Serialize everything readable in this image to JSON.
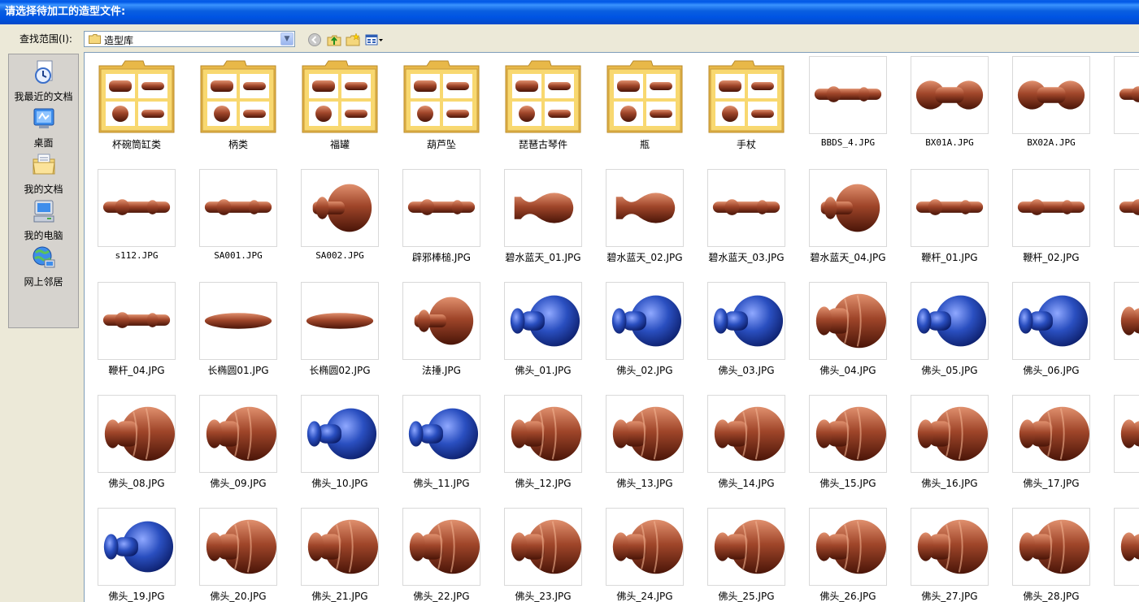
{
  "window": {
    "title": "请选择待加工的造型文件:"
  },
  "lookin": {
    "label": "查找范围(I):",
    "value": "造型库"
  },
  "places": [
    {
      "label": "我最近的文档",
      "icon": "recent-documents-icon"
    },
    {
      "label": "桌面",
      "icon": "desktop-icon"
    },
    {
      "label": "我的文档",
      "icon": "my-documents-icon"
    },
    {
      "label": "我的电脑",
      "icon": "my-computer-icon"
    },
    {
      "label": "网上邻居",
      "icon": "network-places-icon"
    }
  ],
  "files": [
    {
      "name": "杯碗筒缸类",
      "type": "folder"
    },
    {
      "name": "柄类",
      "type": "folder"
    },
    {
      "name": "福罐",
      "type": "folder"
    },
    {
      "name": "葫芦坠",
      "type": "folder"
    },
    {
      "name": "琵琶古琴件",
      "type": "folder"
    },
    {
      "name": "瓶",
      "type": "folder"
    },
    {
      "name": "手杖",
      "type": "folder"
    },
    {
      "name": "BBDS_4.JPG",
      "type": "rod"
    },
    {
      "name": "BX01A.JPG",
      "type": "bead"
    },
    {
      "name": "BX02A.JPG",
      "type": "bead"
    },
    {
      "name": "s",
      "type": "rod"
    },
    {
      "name": "s112.JPG",
      "type": "rod"
    },
    {
      "name": "SA001.JPG",
      "type": "rod"
    },
    {
      "name": "SA002.JPG",
      "type": "knob"
    },
    {
      "name": "辟邪棒槌.JPG",
      "type": "rod"
    },
    {
      "name": "碧水蓝天_01.JPG",
      "type": "vase"
    },
    {
      "name": "碧水蓝天_02.JPG",
      "type": "vase"
    },
    {
      "name": "碧水蓝天_03.JPG",
      "type": "rod"
    },
    {
      "name": "碧水蓝天_04.JPG",
      "type": "knob"
    },
    {
      "name": "鞭杆_01.JPG",
      "type": "rod"
    },
    {
      "name": "鞭杆_02.JPG",
      "type": "rod"
    },
    {
      "name": "鞭杆",
      "type": "rod"
    },
    {
      "name": "鞭杆_04.JPG",
      "type": "rod"
    },
    {
      "name": "长椭圆01.JPG",
      "type": "ellipse"
    },
    {
      "name": "长椭圆02.JPG",
      "type": "ellipse"
    },
    {
      "name": "法捶.JPG",
      "type": "knob"
    },
    {
      "name": "佛头_01.JPG",
      "type": "bluehead"
    },
    {
      "name": "佛头_02.JPG",
      "type": "bluehead"
    },
    {
      "name": "佛头_03.JPG",
      "type": "bluehead"
    },
    {
      "name": "佛头_04.JPG",
      "type": "head"
    },
    {
      "name": "佛头_05.JPG",
      "type": "bluehead"
    },
    {
      "name": "佛头_06.JPG",
      "type": "bluehead"
    },
    {
      "name": "佛头",
      "type": "head"
    },
    {
      "name": "佛头_08.JPG",
      "type": "head"
    },
    {
      "name": "佛头_09.JPG",
      "type": "head"
    },
    {
      "name": "佛头_10.JPG",
      "type": "bluehead"
    },
    {
      "name": "佛头_11.JPG",
      "type": "bluehead"
    },
    {
      "name": "佛头_12.JPG",
      "type": "head"
    },
    {
      "name": "佛头_13.JPG",
      "type": "head"
    },
    {
      "name": "佛头_14.JPG",
      "type": "head"
    },
    {
      "name": "佛头_15.JPG",
      "type": "head"
    },
    {
      "name": "佛头_16.JPG",
      "type": "head"
    },
    {
      "name": "佛头_17.JPG",
      "type": "head"
    },
    {
      "name": "佛头",
      "type": "head"
    },
    {
      "name": "佛头_19.JPG",
      "type": "bluehead"
    },
    {
      "name": "佛头_20.JPG",
      "type": "head"
    },
    {
      "name": "佛头_21.JPG",
      "type": "head"
    },
    {
      "name": "佛头_22.JPG",
      "type": "head"
    },
    {
      "name": "佛头_23.JPG",
      "type": "head"
    },
    {
      "name": "佛头_24.JPG",
      "type": "head"
    },
    {
      "name": "佛头_25.JPG",
      "type": "head"
    },
    {
      "name": "佛头_26.JPG",
      "type": "head"
    },
    {
      "name": "佛头_27.JPG",
      "type": "head"
    },
    {
      "name": "佛头_28.JPG",
      "type": "head"
    },
    {
      "name": "佛头",
      "type": "head"
    }
  ],
  "colors": {
    "titlebar": "#0054E3",
    "wood": "#A0462A",
    "blue": "#2A4FC0",
    "folder": "#F8D870"
  }
}
